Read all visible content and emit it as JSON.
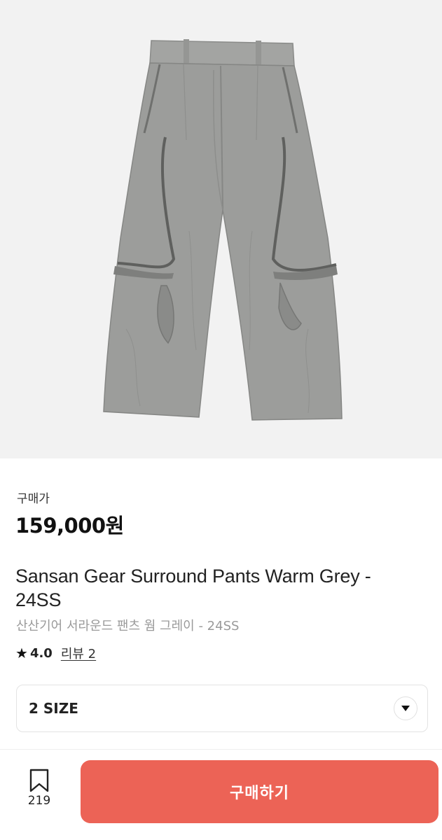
{
  "product": {
    "price_label": "구매가",
    "price": "159,000원",
    "title": "Sansan Gear Surround Pants Warm Grey - 24SS",
    "subtitle": "산산기어 서라운드 팬츠 웜 그레이 - 24SS",
    "rating": "4.0",
    "review_link": "리뷰 2",
    "image_alt": "grey-pants-photo"
  },
  "options": {
    "size_selected": "2 SIZE",
    "icon": "chevron-down-icon"
  },
  "bottom_bar": {
    "wishlist_count": "219",
    "wishlist_icon": "bookmark-icon",
    "buy_label": "구매하기"
  },
  "colors": {
    "buy_button": "#ec6356",
    "image_background": "#f2f2f2",
    "pants": "#9c9d9b"
  }
}
